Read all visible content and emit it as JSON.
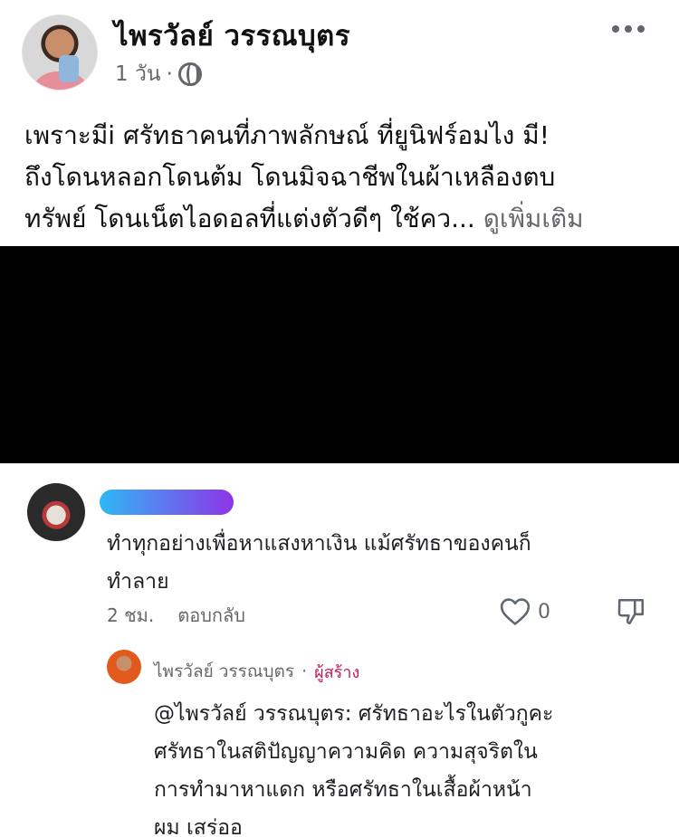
{
  "post": {
    "author": "ไพรวัลย์ วรรณบุตร",
    "time": "1 วัน",
    "separator": "·",
    "icons": {
      "privacy": "globe-icon",
      "menu": "more-horizontal-icon"
    },
    "text_lines": [
      "เพราะมีi ศรัทธาคนที่ภาพลักษณ์ ที่ยูนิฟร์อมไง มี!",
      "ถึงโดนหลอกโดนต้ม โดนมิจฉาชีพในผ้าเหลืองตบ",
      "ทรัพย์ โดนเน็ตไอดอลที่แต่งตัวดีๆ ใช้คว..."
    ],
    "see_more": "ดูเพิ่มเติม"
  },
  "comment": {
    "text_lines": [
      "ทำทุกอย่างเพื่อหาแสงหาเงิน แม้ศรัทธาของคนก็",
      "ทำลาย"
    ],
    "time": "2 ชม.",
    "reply_label": "ตอบกลับ",
    "like_count": "0",
    "icons": {
      "like": "heart-icon",
      "dislike": "thumbs-down-icon"
    }
  },
  "reply": {
    "author": "ไพรวัลย์ วรรณบุตร",
    "separator": "·",
    "badge": "ผู้สร้าง",
    "text_lines": [
      "@ไพรวัลย์ วรรณบุตร: ศรัทธาอะไรในตัวกูคะ",
      "ศรัทธาในสติปัญญาความคิด ความสุจริตใน",
      "การทำมาหาแดก หรือศรัทธาในเสื้อผ้าหน้า",
      "ผม เสร่ออ"
    ]
  },
  "colors": {
    "secondary_text": "#65676b",
    "creator_badge": "#c4185b",
    "redaction_gradient_start": "#2fb8f4",
    "redaction_gradient_end": "#8e35e6"
  }
}
